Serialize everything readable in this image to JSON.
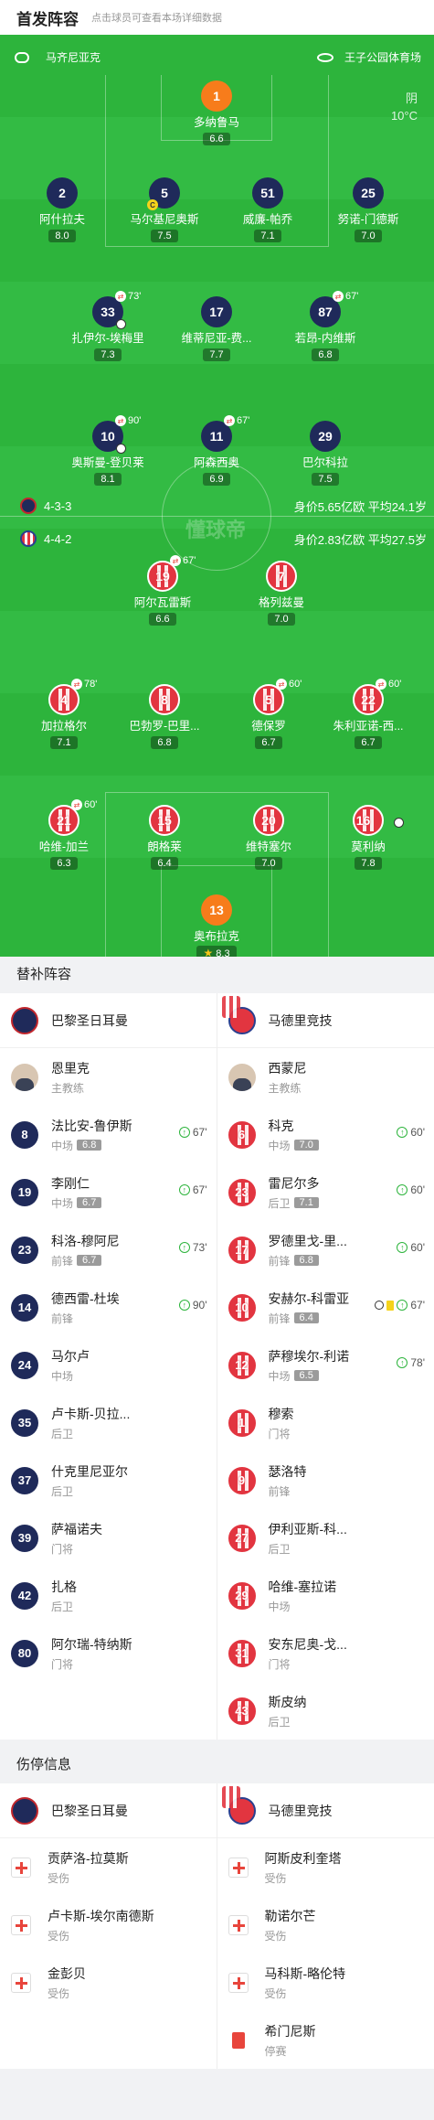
{
  "header": {
    "title": "首发阵容",
    "hint": "点击球员可查看本场详细数据"
  },
  "pitch": {
    "venue_left": "马齐尼亚克",
    "venue_right": "王子公园体育场",
    "weather": "阴",
    "temperature": "10°C",
    "watermark": "懂球帝",
    "home_formation": "4-3-3",
    "home_stats": "身价5.65亿欧  平均24.1岁",
    "away_formation": "4-4-2",
    "away_stats": "身价2.83亿欧  平均27.5岁"
  },
  "home_players": [
    {
      "num": "1",
      "name": "多纳鲁马",
      "rating": "6.6",
      "kit": "gk"
    },
    {
      "num": "2",
      "name": "阿什拉夫",
      "rating": "8.0",
      "kit": "psg"
    },
    {
      "num": "5",
      "name": "马尔基尼奥斯",
      "rating": "7.5",
      "kit": "psg",
      "captain": "C"
    },
    {
      "num": "51",
      "name": "威廉-帕乔",
      "rating": "7.1",
      "kit": "psg"
    },
    {
      "num": "25",
      "name": "努诺-门德斯",
      "rating": "7.0",
      "kit": "psg"
    },
    {
      "num": "33",
      "name": "扎伊尔-埃梅里",
      "rating": "7.3",
      "kit": "psg",
      "sub": "73'",
      "goal": true
    },
    {
      "num": "17",
      "name": "维蒂尼亚-费...",
      "rating": "7.7",
      "kit": "psg"
    },
    {
      "num": "87",
      "name": "若昂-内维斯",
      "rating": "6.8",
      "kit": "psg",
      "sub": "67'"
    },
    {
      "num": "10",
      "name": "奥斯曼-登贝莱",
      "rating": "8.1",
      "kit": "psg",
      "sub": "90'",
      "goal": true
    },
    {
      "num": "11",
      "name": "阿森西奥",
      "rating": "6.9",
      "kit": "psg",
      "sub": "67'"
    },
    {
      "num": "29",
      "name": "巴尔科拉",
      "rating": "7.5",
      "kit": "psg"
    }
  ],
  "away_players": [
    {
      "num": "19",
      "name": "阿尔瓦雷斯",
      "rating": "6.6",
      "sub": "67'"
    },
    {
      "num": "7",
      "name": "格列兹曼",
      "rating": "7.0"
    },
    {
      "num": "4",
      "name": "加拉格尔",
      "rating": "7.1",
      "sub": "78'"
    },
    {
      "num": "8",
      "name": "巴勃罗-巴里...",
      "rating": "6.8"
    },
    {
      "num": "5",
      "name": "德保罗",
      "rating": "6.7",
      "sub": "60'"
    },
    {
      "num": "22",
      "name": "朱利亚诺-西...",
      "rating": "6.7",
      "sub": "60'"
    },
    {
      "num": "21",
      "name": "哈维-加兰",
      "rating": "6.3",
      "sub": "60'"
    },
    {
      "num": "15",
      "name": "朗格莱",
      "rating": "6.4"
    },
    {
      "num": "20",
      "name": "维特塞尔",
      "rating": "7.0"
    },
    {
      "num": "16",
      "name": "莫利纳",
      "rating": "7.8",
      "goal": true
    },
    {
      "num": "13",
      "name": "奥布拉克",
      "rating": "8.3",
      "kit": "gk",
      "captain": "C",
      "star": "★"
    }
  ],
  "subs_section": {
    "title": "替补阵容",
    "home_team": "巴黎圣日耳曼",
    "away_team": "马德里竞技",
    "home_coach": {
      "name": "恩里克",
      "role": "主教练"
    },
    "away_coach": {
      "name": "西蒙尼",
      "role": "主教练"
    },
    "home_subs": [
      {
        "num": "8",
        "name": "法比安-鲁伊斯",
        "pos": "中场",
        "rating": "6.8",
        "sub": "67'"
      },
      {
        "num": "19",
        "name": "李刚仁",
        "pos": "中场",
        "rating": "6.7",
        "sub": "67'"
      },
      {
        "num": "23",
        "name": "科洛-穆阿尼",
        "pos": "前锋",
        "rating": "6.7",
        "sub": "73'"
      },
      {
        "num": "14",
        "name": "德西雷-杜埃",
        "pos": "前锋",
        "rating": "",
        "sub": "90'"
      },
      {
        "num": "24",
        "name": "马尔卢",
        "pos": "中场",
        "rating": "",
        "sub": ""
      },
      {
        "num": "35",
        "name": "卢卡斯-贝拉...",
        "pos": "后卫",
        "rating": "",
        "sub": ""
      },
      {
        "num": "37",
        "name": "什克里尼亚尔",
        "pos": "后卫",
        "rating": "",
        "sub": ""
      },
      {
        "num": "39",
        "name": "萨福诺夫",
        "pos": "门将",
        "rating": "",
        "sub": ""
      },
      {
        "num": "42",
        "name": "扎格",
        "pos": "后卫",
        "rating": "",
        "sub": ""
      },
      {
        "num": "80",
        "name": "阿尔瑞-特纳斯",
        "pos": "门将",
        "rating": "",
        "sub": ""
      }
    ],
    "away_subs": [
      {
        "num": "6",
        "name": "科克",
        "pos": "中场",
        "rating": "7.0",
        "sub": "60'"
      },
      {
        "num": "23",
        "name": "雷尼尔多",
        "pos": "后卫",
        "rating": "7.1",
        "sub": "60'"
      },
      {
        "num": "17",
        "name": "罗德里戈-里...",
        "pos": "前锋",
        "rating": "6.8",
        "sub": "60'"
      },
      {
        "num": "10",
        "name": "安赫尔-科雷亚",
        "pos": "前锋",
        "rating": "6.4",
        "sub": "67'",
        "goal": true,
        "yellow": true
      },
      {
        "num": "12",
        "name": "萨穆埃尔-利诺",
        "pos": "中场",
        "rating": "6.5",
        "sub": "78'"
      },
      {
        "num": "1",
        "name": "穆索",
        "pos": "门将",
        "rating": "",
        "sub": ""
      },
      {
        "num": "9",
        "name": "瑟洛特",
        "pos": "前锋",
        "rating": "",
        "sub": ""
      },
      {
        "num": "27",
        "name": "伊利亚斯-科...",
        "pos": "后卫",
        "rating": "",
        "sub": ""
      },
      {
        "num": "29",
        "name": "哈维-塞拉诺",
        "pos": "中场",
        "rating": "",
        "sub": ""
      },
      {
        "num": "31",
        "name": "安东尼奥-戈...",
        "pos": "门将",
        "rating": "",
        "sub": ""
      },
      {
        "num": "43",
        "name": "斯皮纳",
        "pos": "后卫",
        "rating": "",
        "sub": ""
      }
    ]
  },
  "injury_section": {
    "title": "伤停信息",
    "home_team": "巴黎圣日耳曼",
    "away_team": "马德里竞技",
    "home": [
      {
        "name": "贡萨洛-拉莫斯",
        "status": "受伤",
        "type": "injury"
      },
      {
        "name": "卢卡斯-埃尔南德斯",
        "status": "受伤",
        "type": "injury"
      },
      {
        "name": "金彭贝",
        "status": "受伤",
        "type": "injury"
      }
    ],
    "away": [
      {
        "name": "阿斯皮利奎塔",
        "status": "受伤",
        "type": "injury"
      },
      {
        "name": "勒诺尔芒",
        "status": "受伤",
        "type": "injury"
      },
      {
        "name": "马科斯-略伦特",
        "status": "受伤",
        "type": "injury"
      },
      {
        "name": "希门尼斯",
        "status": "停赛",
        "type": "suspended"
      }
    ]
  }
}
